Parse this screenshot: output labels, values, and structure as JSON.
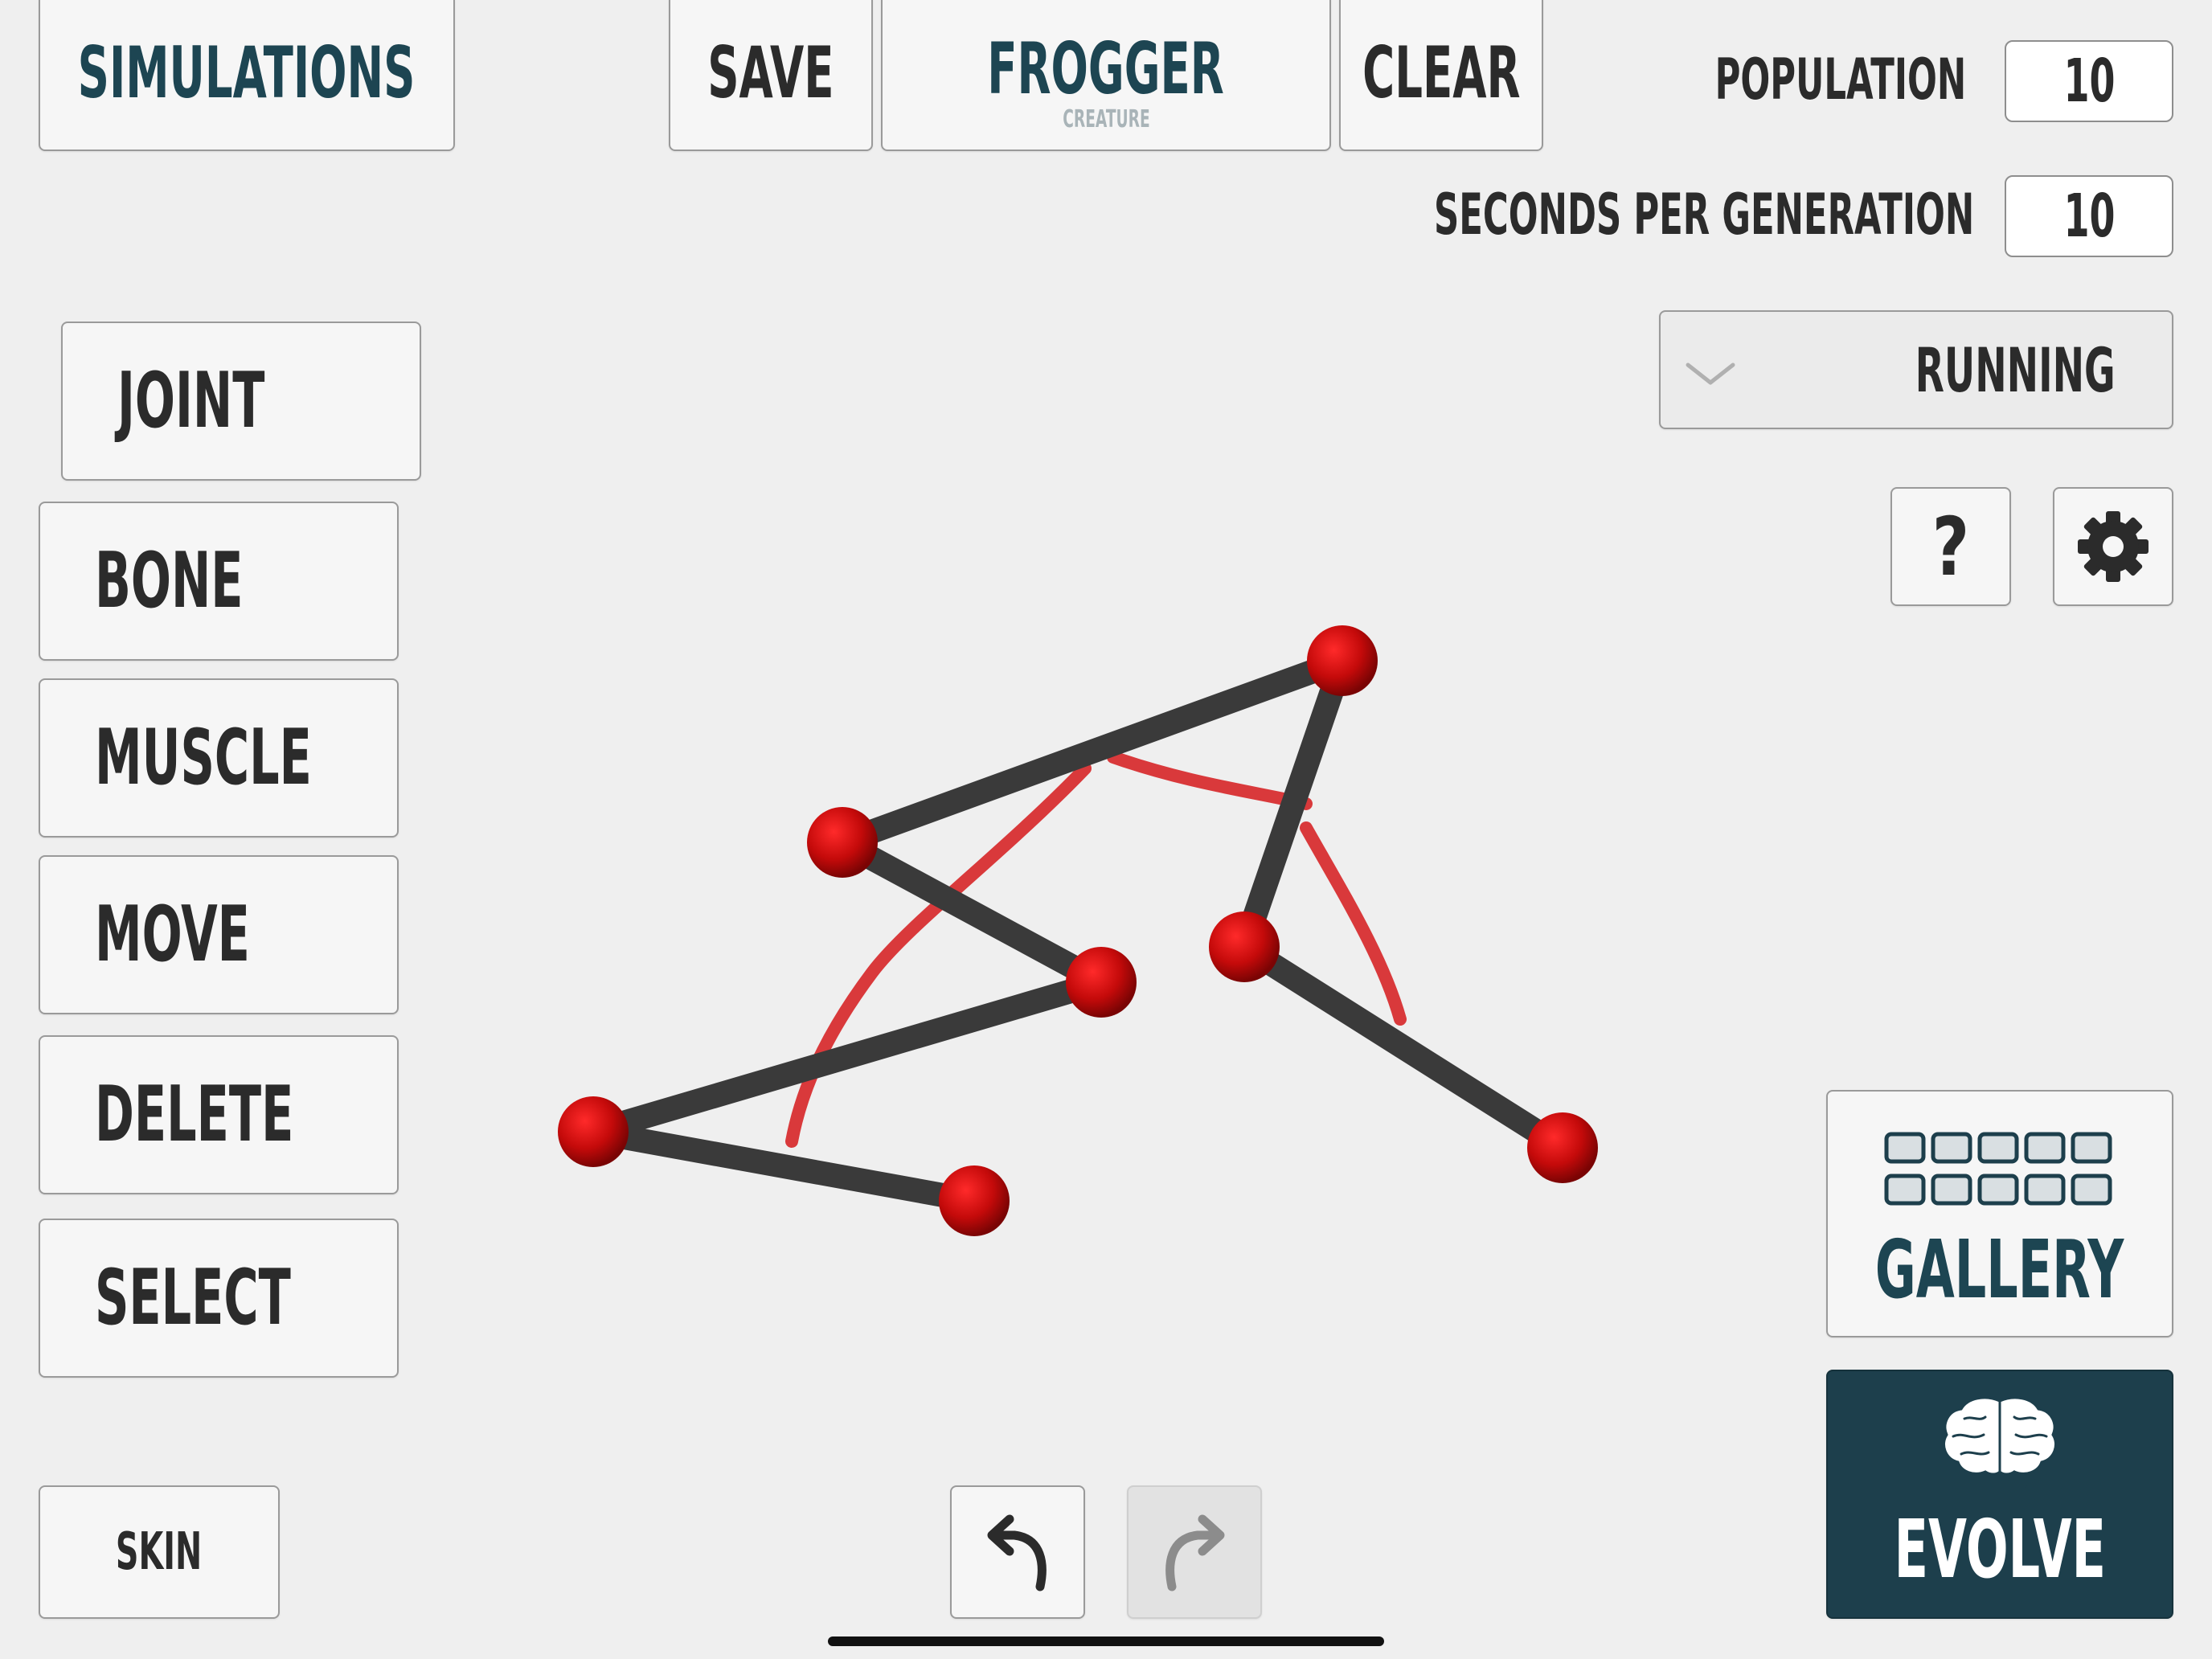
{
  "toolbar": {
    "simulations_label": "SIMULATIONS",
    "save_label": "SAVE",
    "creature_name": "FROGGER",
    "creature_caption": "CREATURE",
    "clear_label": "CLEAR"
  },
  "settings": {
    "population_label": "POPULATION",
    "population_value": "10",
    "seconds_label": "SECONDS PER GENERATION",
    "seconds_value": "10",
    "mode_selected": "RUNNING"
  },
  "tools": {
    "joint": "JOINT",
    "bone": "BONE",
    "muscle": "MUSCLE",
    "move": "MOVE",
    "delete": "DELETE",
    "select": "SELECT",
    "skin": "SKIN"
  },
  "actions": {
    "help_glyph": "?",
    "gallery_label": "GALLERY",
    "evolve_label": "EVOLVE"
  },
  "icons": {
    "help": "question-icon",
    "settings": "gear-icon",
    "dropdown": "chevron-down-icon",
    "undo": "undo-arrow-icon",
    "redo": "redo-arrow-icon",
    "gallery": "grid-icon",
    "evolve": "brain-icon"
  },
  "colors": {
    "accent": "#1d3f4c",
    "joint": "#c40a0a",
    "bone": "#3a3a3a",
    "muscle": "#d9393b"
  },
  "creature": {
    "joints": 7,
    "bones": 6,
    "muscles": 3
  }
}
